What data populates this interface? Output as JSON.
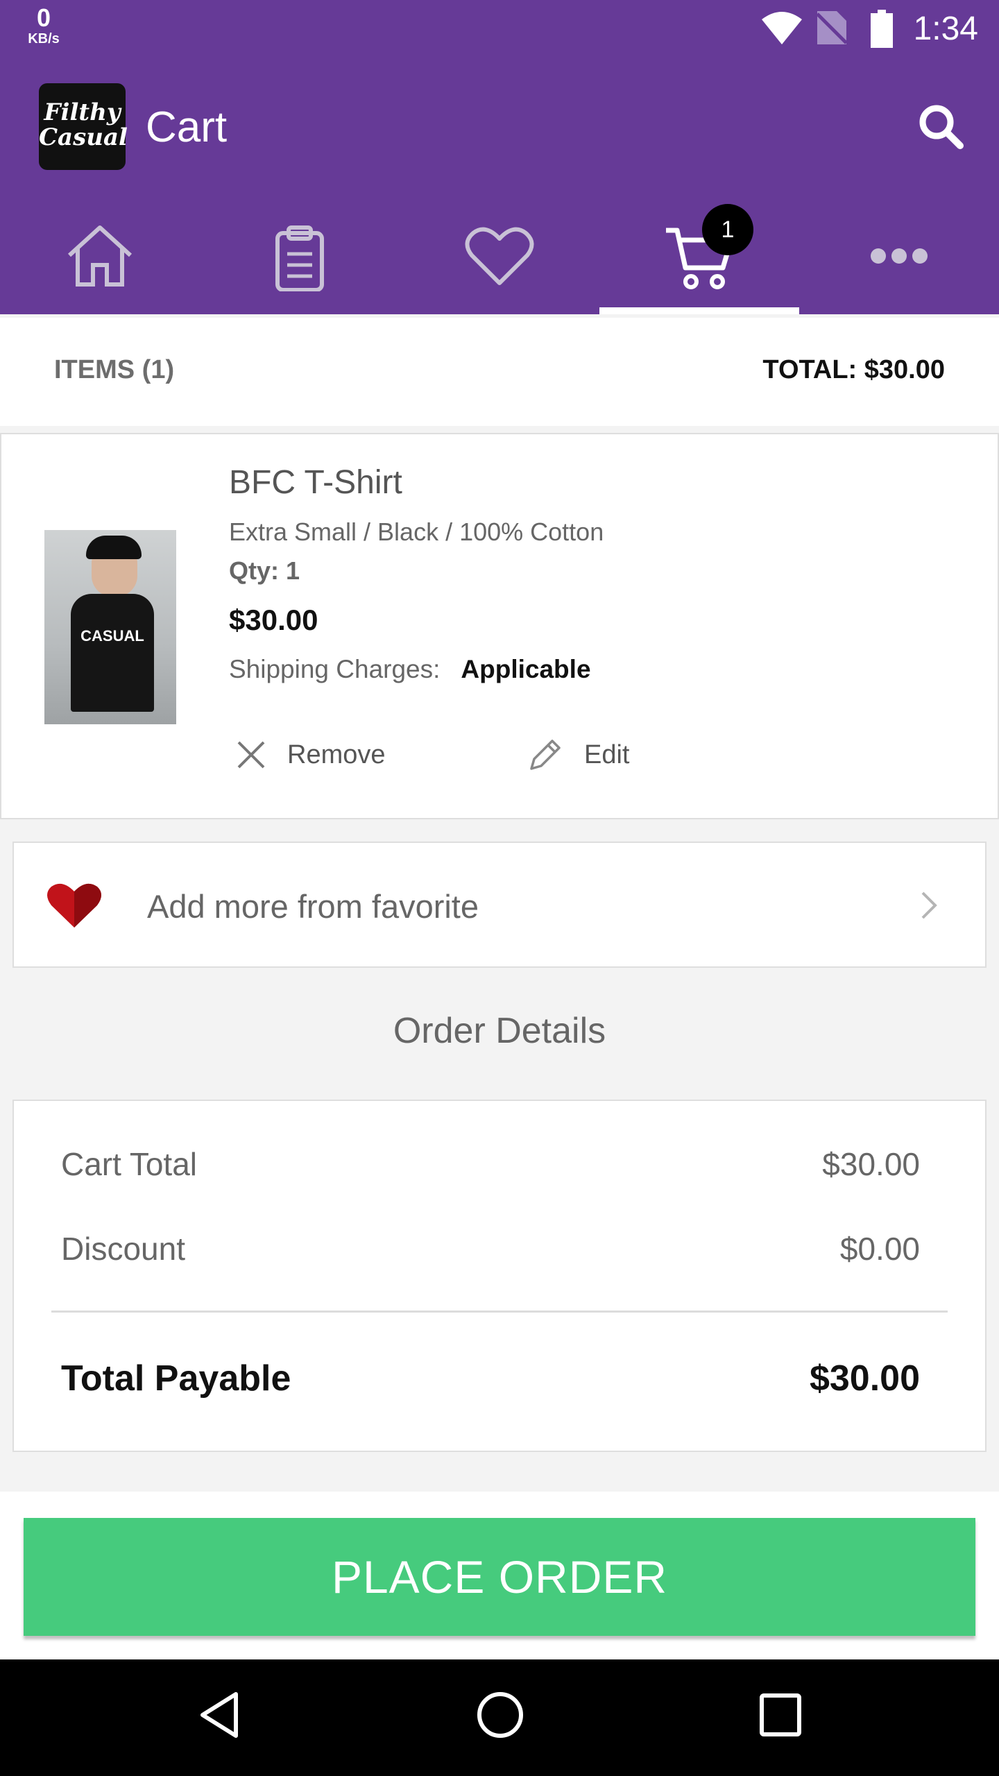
{
  "status_bar": {
    "speed_value": "0",
    "speed_unit": "KB/s",
    "time": "1:34"
  },
  "app_bar": {
    "logo_text": "Filthy Casual",
    "title": "Cart"
  },
  "nav_tabs": [
    {
      "name": "home",
      "icon": "home-icon"
    },
    {
      "name": "orders",
      "icon": "clipboard-icon"
    },
    {
      "name": "favorites",
      "icon": "heart-outline-icon"
    },
    {
      "name": "cart",
      "icon": "cart-icon",
      "badge": "1",
      "active": true
    },
    {
      "name": "more",
      "icon": "more-dots-icon"
    }
  ],
  "summary": {
    "items_label": "ITEMS (1)",
    "total_label": "TOTAL: $30.00"
  },
  "product": {
    "name": "BFC T-Shirt",
    "variant": "Extra Small / Black / 100% Cotton",
    "qty": "Qty: 1",
    "price": "$30.00",
    "shipping_label": "Shipping Charges:",
    "shipping_value": "Applicable",
    "remove_label": "Remove",
    "edit_label": "Edit",
    "image_text": "CASUAL"
  },
  "favorite": {
    "label": "Add more from favorite"
  },
  "order_details": {
    "heading": "Order Details",
    "rows": [
      {
        "label": "Cart Total",
        "value": "$30.00"
      },
      {
        "label": "Discount",
        "value": "$0.00"
      }
    ],
    "total_label": "Total Payable",
    "total_value": "$30.00"
  },
  "place_order_label": "PLACE ORDER",
  "colors": {
    "primary": "#663a97",
    "button": "#46cb7d",
    "heart": "#c1131a"
  }
}
